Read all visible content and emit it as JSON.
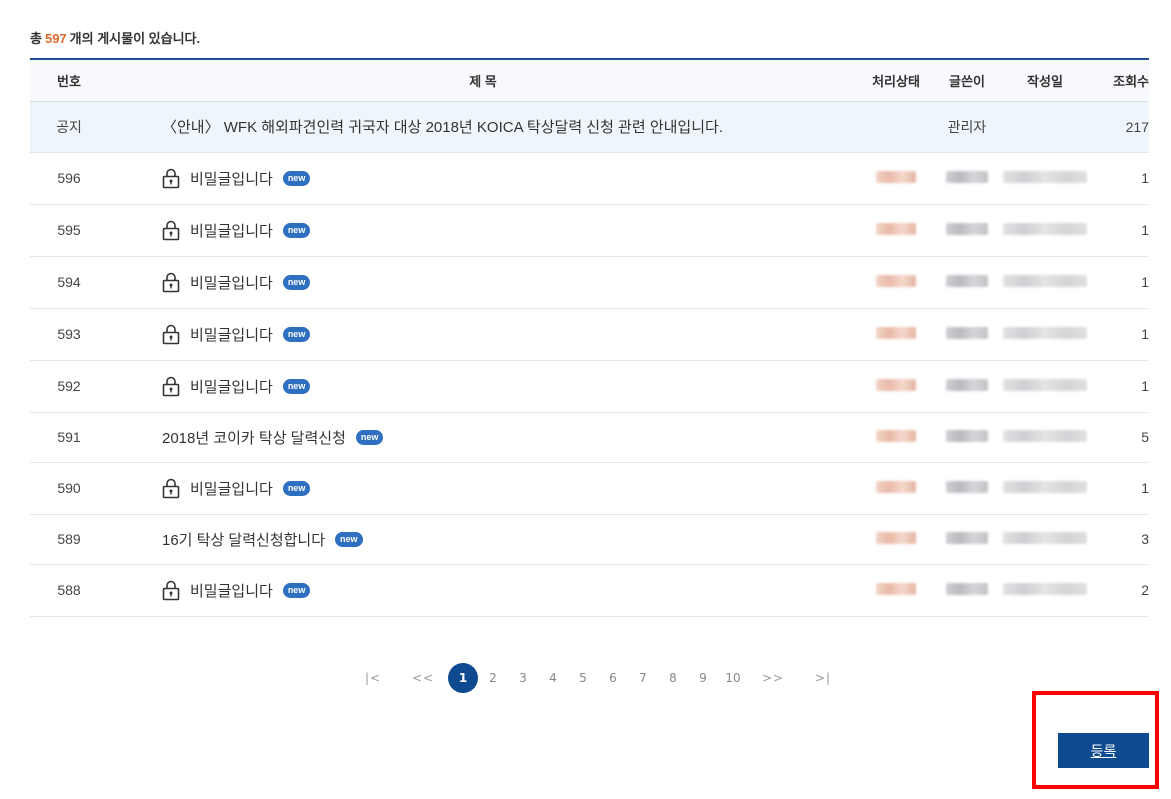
{
  "summary": {
    "prefix": "총",
    "count": "597",
    "suffix": "개의 게시물이 있습니다."
  },
  "columns": {
    "num": "번호",
    "title": "제 목",
    "status": "처리상태",
    "author": "글쓴이",
    "date": "작성일",
    "views": "조회수"
  },
  "notice": {
    "num": "공지",
    "title": "〈안내〉 WFK 해외파견인력 귀국자 대상 2018년 KOICA 탁상달력 신청 관련 안내입니다.",
    "author": "관리자",
    "views": "217"
  },
  "posts": [
    {
      "num": "596",
      "title": "비밀글입니다",
      "locked": true,
      "badge": "new",
      "views": "1"
    },
    {
      "num": "595",
      "title": "비밀글입니다",
      "locked": true,
      "badge": "new",
      "views": "1"
    },
    {
      "num": "594",
      "title": "비밀글입니다",
      "locked": true,
      "badge": "new",
      "views": "1"
    },
    {
      "num": "593",
      "title": "비밀글입니다",
      "locked": true,
      "badge": "new",
      "views": "1"
    },
    {
      "num": "592",
      "title": "비밀글입니다",
      "locked": true,
      "badge": "new",
      "views": "1"
    },
    {
      "num": "591",
      "title": "2018년 코이카 탁상 달력신청",
      "locked": false,
      "badge": "new",
      "views": "5"
    },
    {
      "num": "590",
      "title": "비밀글입니다",
      "locked": true,
      "badge": "new",
      "views": "1"
    },
    {
      "num": "589",
      "title": "16기 탁상 달력신청합니다",
      "locked": false,
      "badge": "new",
      "views": "3"
    },
    {
      "num": "588",
      "title": "비밀글입니다",
      "locked": true,
      "badge": "new",
      "views": "2"
    }
  ],
  "pagination": {
    "first": "|<",
    "prev": "<<",
    "pages": [
      "1",
      "2",
      "3",
      "4",
      "5",
      "6",
      "7",
      "8",
      "9",
      "10"
    ],
    "current": "1",
    "next": ">>",
    "last": ">|"
  },
  "register_button": "등록",
  "colors": {
    "accent": "#0d4a8f",
    "count": "#e06a2b",
    "badge": "#2f6fbf",
    "highlight": "#ff0000"
  },
  "icons": {
    "lock": "lock-icon"
  }
}
